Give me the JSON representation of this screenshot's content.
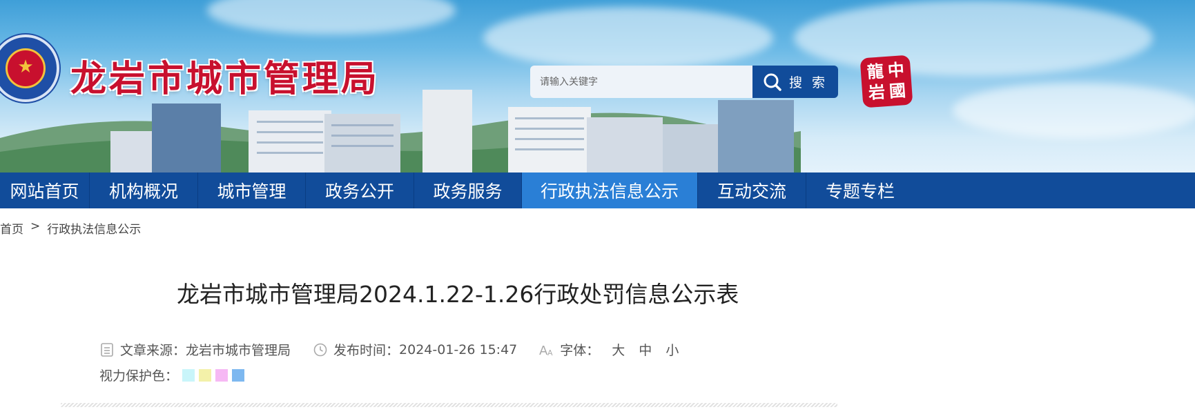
{
  "header": {
    "site_title": "龙岩市城市管理局",
    "search": {
      "placeholder": "请输入关键字",
      "button_label": "搜 索"
    },
    "seal_chars": [
      "中",
      "龍",
      "國",
      "岩"
    ]
  },
  "nav": {
    "items": [
      {
        "label": "网站首页",
        "active": false
      },
      {
        "label": "机构概况",
        "active": false
      },
      {
        "label": "城市管理",
        "active": false
      },
      {
        "label": "政务公开",
        "active": false
      },
      {
        "label": "政务服务",
        "active": false
      },
      {
        "label": "行政执法信息公示",
        "active": true
      },
      {
        "label": "互动交流",
        "active": false
      },
      {
        "label": "专题专栏",
        "active": false
      }
    ]
  },
  "breadcrumb": {
    "home": "首页",
    "separator": ">",
    "current": "行政执法信息公示"
  },
  "article": {
    "title": "龙岩市城市管理局2024.1.22-1.26行政处罚信息公示表",
    "source_label": "文章来源：",
    "source_value": "龙岩市城市管理局",
    "time_label": "发布时间：",
    "time_value": "2024-01-26 15:47",
    "font_label": "字体：",
    "font_sizes": [
      "大",
      "中",
      "小"
    ],
    "eye_label": "视力保护色：",
    "eye_colors": [
      "#c9f5fa",
      "#f3f1a9",
      "#f6b8f4",
      "#7db8f0"
    ]
  },
  "colors": {
    "nav_bg": "#114c9a",
    "nav_active": "#2a7fd6",
    "title_red": "#c8102e"
  }
}
